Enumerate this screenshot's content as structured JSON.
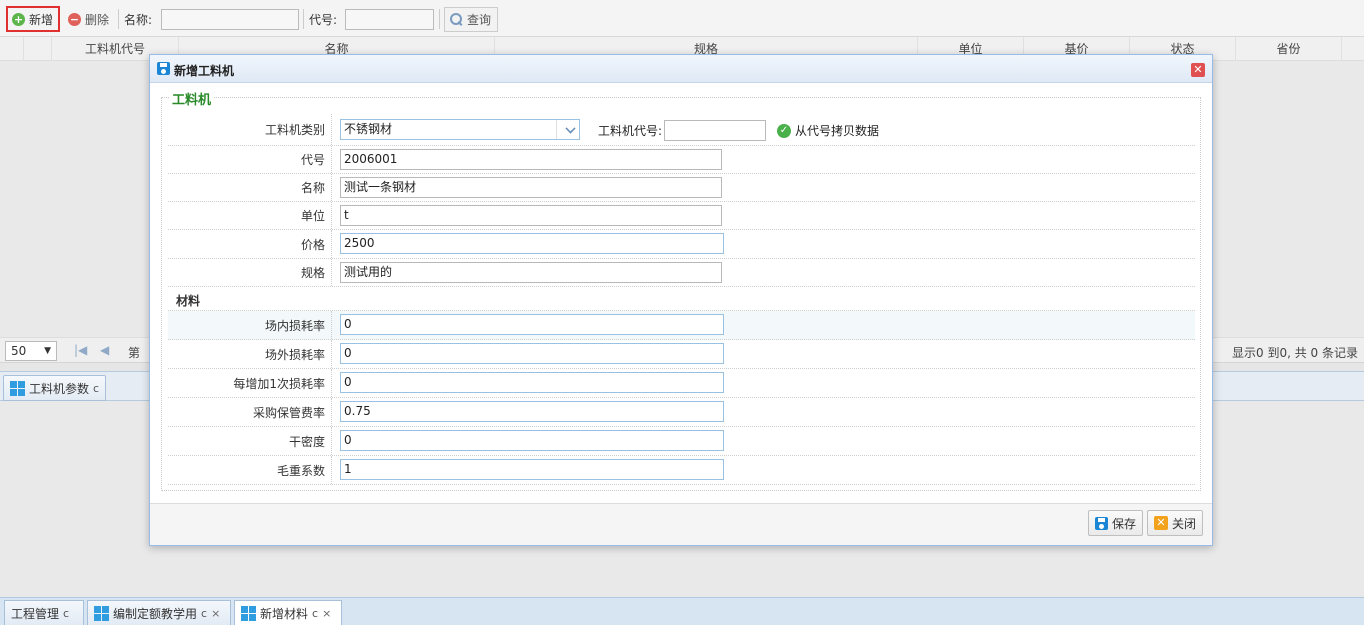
{
  "toolbar": {
    "add_label": "新增",
    "delete_label": "删除",
    "name_label": "名称:",
    "code_label": "代号:",
    "name_value": "",
    "code_value": "",
    "query_label": "查询"
  },
  "grid": {
    "columns": [
      "工料机代号",
      "名称",
      "规格",
      "单位",
      "基价",
      "状态",
      "省份"
    ]
  },
  "pager": {
    "page_size": "50",
    "page_prefix": "第",
    "summary": "显示0 到0, 共 0 条记录"
  },
  "sub_panel": {
    "tab_label": "工料机参数",
    "refresh_glyph": "c"
  },
  "bottom_tabs": [
    {
      "label": "工程管理",
      "refresh": "c"
    },
    {
      "label": "编制定额教学用",
      "refresh": "c",
      "close": "×"
    },
    {
      "label": "新增材料",
      "refresh": "c",
      "close": "×"
    }
  ],
  "dialog": {
    "title": "新增工料机",
    "legend": "工料机",
    "category_label": "工料机类别",
    "category_value": "不锈钢材",
    "machine_code_label": "工料机代号:",
    "machine_code_value": "",
    "copy_label": "从代号拷贝数据",
    "fields": {
      "code": {
        "label": "代号",
        "value": "2006001"
      },
      "name": {
        "label": "名称",
        "value": "测试一条钢材"
      },
      "unit": {
        "label": "单位",
        "value": "t"
      },
      "price": {
        "label": "价格",
        "value": "2500"
      },
      "spec": {
        "label": "规格",
        "value": "测试用的"
      }
    },
    "section_material": "材料",
    "material_fields": {
      "inside_loss": {
        "label": "场内损耗率",
        "value": "0"
      },
      "outside_loss": {
        "label": "场外损耗率",
        "value": "0"
      },
      "per_add_loss": {
        "label": "每增加1次损耗率",
        "value": "0"
      },
      "purchase_fee": {
        "label": "采购保管费率",
        "value": "0.75"
      },
      "dry_density": {
        "label": "干密度",
        "value": "0"
      },
      "gross_weight": {
        "label": "毛重系数",
        "value": "1"
      }
    },
    "save_label": "保存",
    "close_label": "关闭"
  }
}
